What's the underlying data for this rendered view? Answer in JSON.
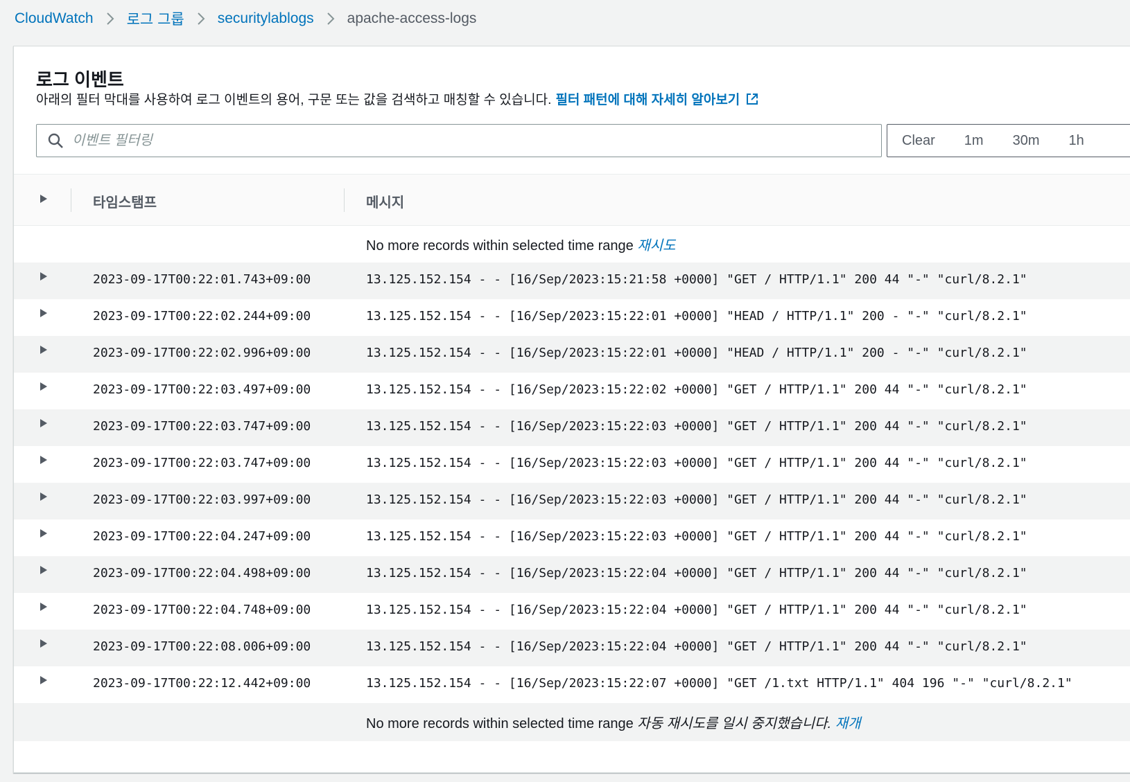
{
  "breadcrumb": {
    "items": [
      "CloudWatch",
      "로그 그룹",
      "securitylablogs"
    ],
    "current": "apache-access-logs"
  },
  "panel": {
    "title": "로그 이벤트",
    "description": "아래의 필터 막대를 사용하여 로그 이벤트의 용어, 구문 또는 값을 검색하고 매칭할 수 있습니다.",
    "learn_more": "필터 패턴에 대해 자세히 알아보기"
  },
  "search": {
    "placeholder": "이벤트 필터링",
    "value": ""
  },
  "time_range": {
    "buttons": [
      "Clear",
      "1m",
      "30m",
      "1h"
    ]
  },
  "table": {
    "columns": {
      "timestamp": "타임스탬프",
      "message": "메시지"
    },
    "top_status": {
      "text": "No more records within selected time range",
      "link": "재시도"
    },
    "rows": [
      {
        "timestamp": "2023-09-17T00:22:01.743+09:00",
        "message": "13.125.152.154 - - [16/Sep/2023:15:21:58 +0000] \"GET / HTTP/1.1\" 200 44 \"-\" \"curl/8.2.1\""
      },
      {
        "timestamp": "2023-09-17T00:22:02.244+09:00",
        "message": "13.125.152.154 - - [16/Sep/2023:15:22:01 +0000] \"HEAD / HTTP/1.1\" 200 - \"-\" \"curl/8.2.1\""
      },
      {
        "timestamp": "2023-09-17T00:22:02.996+09:00",
        "message": "13.125.152.154 - - [16/Sep/2023:15:22:01 +0000] \"HEAD / HTTP/1.1\" 200 - \"-\" \"curl/8.2.1\""
      },
      {
        "timestamp": "2023-09-17T00:22:03.497+09:00",
        "message": "13.125.152.154 - - [16/Sep/2023:15:22:02 +0000] \"GET / HTTP/1.1\" 200 44 \"-\" \"curl/8.2.1\""
      },
      {
        "timestamp": "2023-09-17T00:22:03.747+09:00",
        "message": "13.125.152.154 - - [16/Sep/2023:15:22:03 +0000] \"GET / HTTP/1.1\" 200 44 \"-\" \"curl/8.2.1\""
      },
      {
        "timestamp": "2023-09-17T00:22:03.747+09:00",
        "message": "13.125.152.154 - - [16/Sep/2023:15:22:03 +0000] \"GET / HTTP/1.1\" 200 44 \"-\" \"curl/8.2.1\""
      },
      {
        "timestamp": "2023-09-17T00:22:03.997+09:00",
        "message": "13.125.152.154 - - [16/Sep/2023:15:22:03 +0000] \"GET / HTTP/1.1\" 200 44 \"-\" \"curl/8.2.1\""
      },
      {
        "timestamp": "2023-09-17T00:22:04.247+09:00",
        "message": "13.125.152.154 - - [16/Sep/2023:15:22:03 +0000] \"GET / HTTP/1.1\" 200 44 \"-\" \"curl/8.2.1\""
      },
      {
        "timestamp": "2023-09-17T00:22:04.498+09:00",
        "message": "13.125.152.154 - - [16/Sep/2023:15:22:04 +0000] \"GET / HTTP/1.1\" 200 44 \"-\" \"curl/8.2.1\""
      },
      {
        "timestamp": "2023-09-17T00:22:04.748+09:00",
        "message": "13.125.152.154 - - [16/Sep/2023:15:22:04 +0000] \"GET / HTTP/1.1\" 200 44 \"-\" \"curl/8.2.1\""
      },
      {
        "timestamp": "2023-09-17T00:22:08.006+09:00",
        "message": "13.125.152.154 - - [16/Sep/2023:15:22:04 +0000] \"GET / HTTP/1.1\" 200 44 \"-\" \"curl/8.2.1\""
      },
      {
        "timestamp": "2023-09-17T00:22:12.442+09:00",
        "message": "13.125.152.154 - - [16/Sep/2023:15:22:07 +0000] \"GET /1.txt HTTP/1.1\" 404 196 \"-\" \"curl/8.2.1\""
      }
    ],
    "bottom_status": {
      "text": "No more records within selected time range",
      "note": "자동 재시도를 일시 중지했습니다.",
      "link": "재개"
    }
  },
  "colors": {
    "link": "#0073bb",
    "text": "#16191f",
    "muted": "#545b64",
    "row_alt": "#f2f3f3"
  },
  "icons": [
    "chevron-right-icon",
    "external-link-icon",
    "search-icon",
    "caret-right-icon"
  ]
}
